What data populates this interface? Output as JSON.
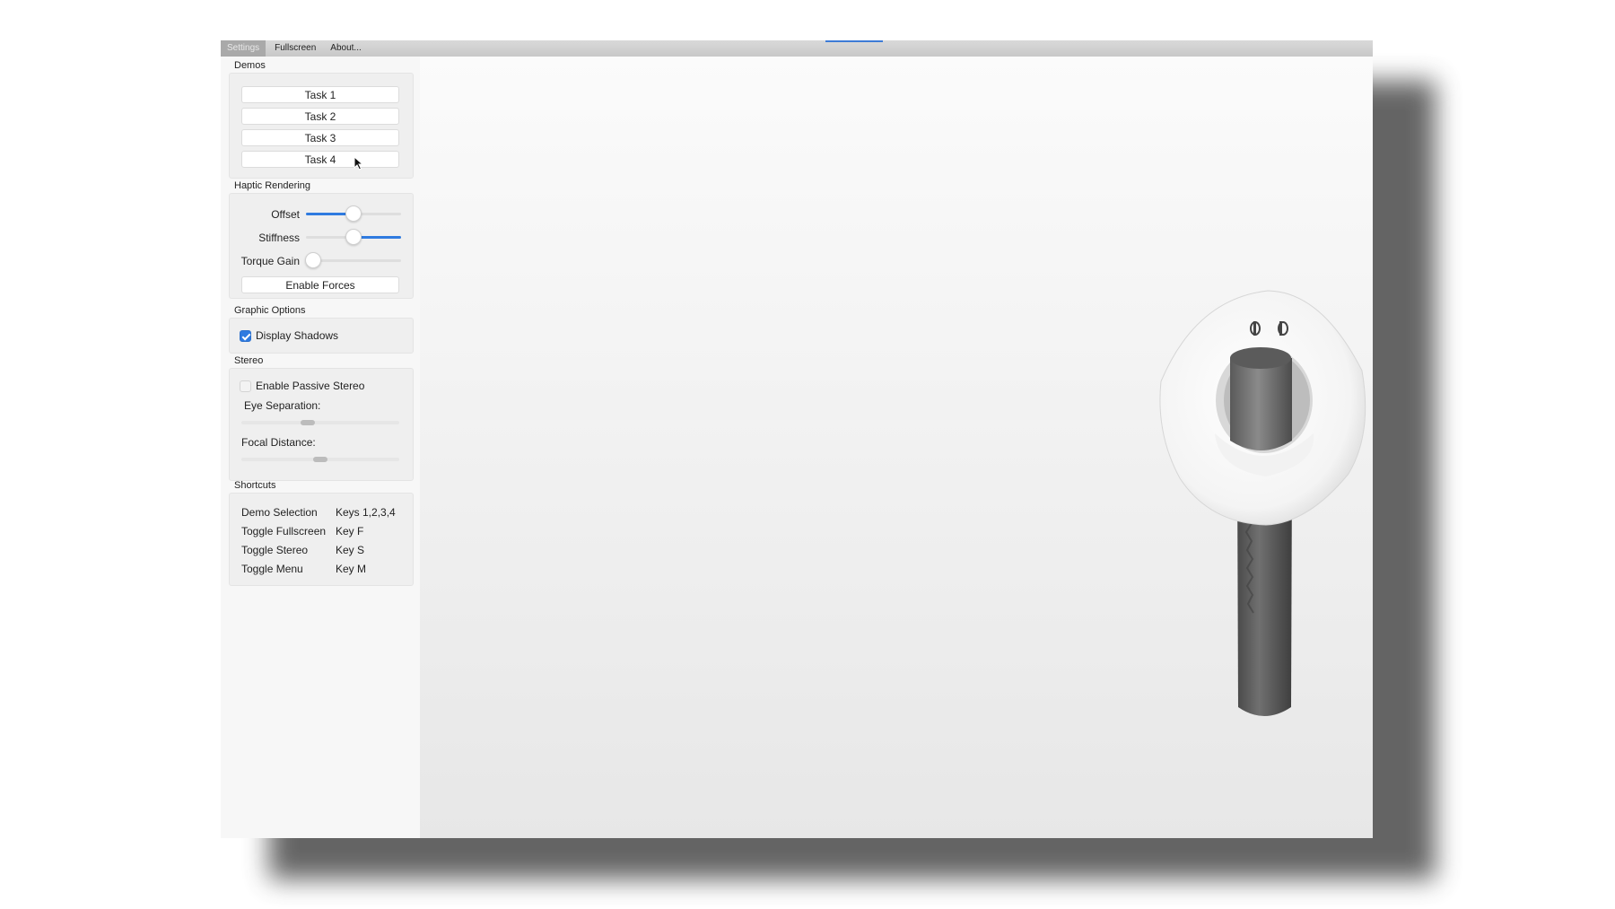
{
  "menubar": {
    "items": [
      {
        "label": "Settings"
      },
      {
        "label": "Fullscreen"
      },
      {
        "label": "About..."
      }
    ]
  },
  "sidebar": {
    "demos": {
      "title": "Demos",
      "tasks": [
        {
          "label": "Task 1"
        },
        {
          "label": "Task 2"
        },
        {
          "label": "Task 3"
        },
        {
          "label": "Task 4"
        }
      ]
    },
    "haptic": {
      "title": "Haptic Rendering",
      "sliders": [
        {
          "label": "Offset",
          "value": 0.5
        },
        {
          "label": "Stiffness",
          "value": 0.5
        },
        {
          "label": "Torque Gain",
          "value": 0.08
        }
      ],
      "enable_forces_label": "Enable Forces"
    },
    "graphics": {
      "title": "Graphic Options",
      "display_shadows_label": "Display Shadows",
      "display_shadows_checked": true
    },
    "stereo": {
      "title": "Stereo",
      "enable_passive_label": "Enable Passive Stereo",
      "enable_passive_checked": false,
      "eye_separation_label": "Eye Separation:",
      "eye_separation_value": 0.42,
      "focal_distance_label": "Focal Distance:",
      "focal_distance_value": 0.5
    },
    "shortcuts": {
      "title": "Shortcuts",
      "rows": [
        {
          "action": "Demo Selection",
          "key": "Keys 1,2,3,4"
        },
        {
          "action": "Toggle Fullscreen",
          "key": "Key F"
        },
        {
          "action": "Toggle Stereo",
          "key": "Key S"
        },
        {
          "action": "Toggle Menu",
          "key": "Key M"
        }
      ]
    }
  },
  "colors": {
    "accent": "#2f7be0",
    "sidebar_bg": "#f7f7f7",
    "viewport_bg": "#f2f2f2"
  }
}
